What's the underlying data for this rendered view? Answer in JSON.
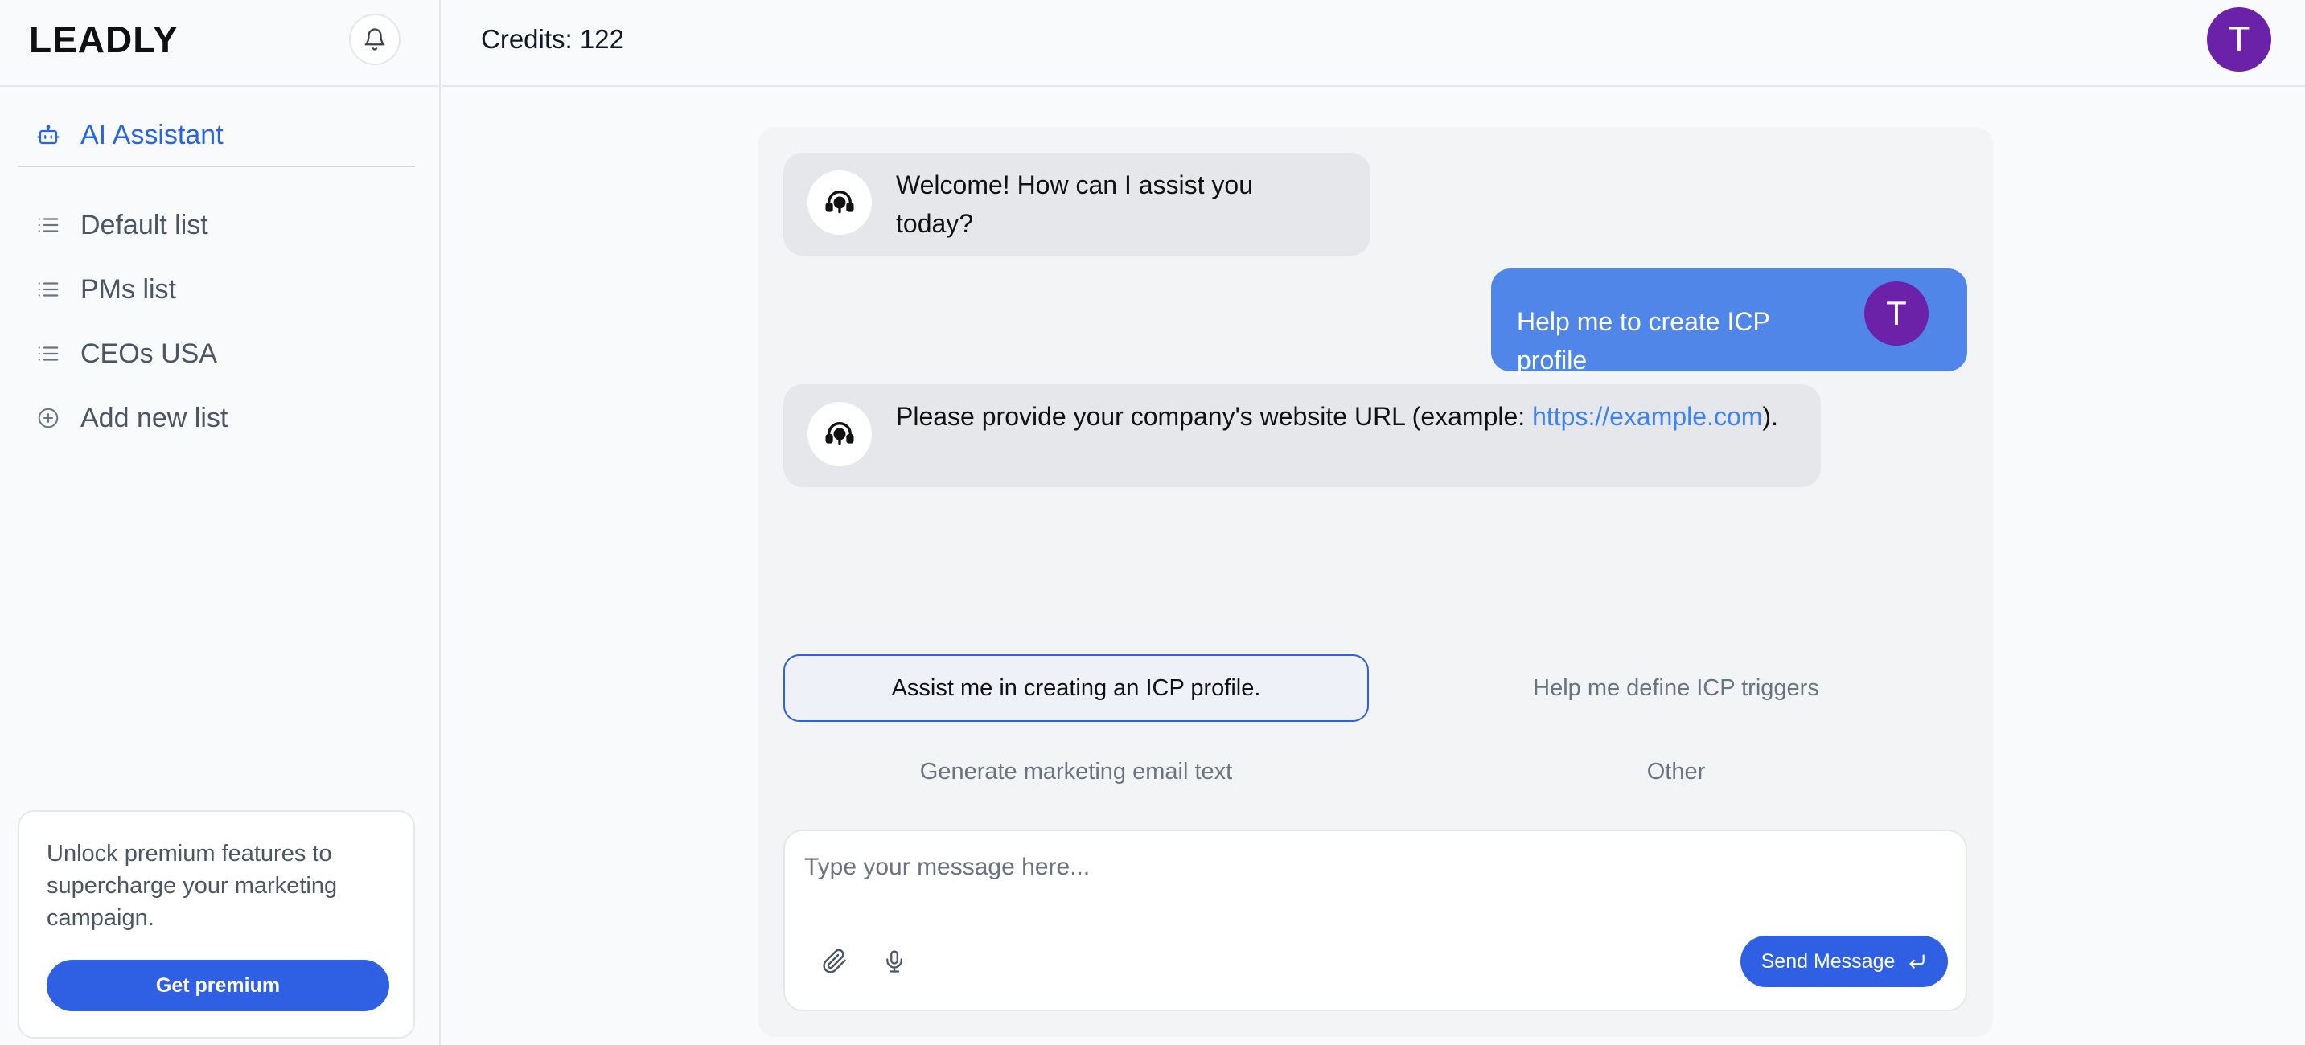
{
  "app": {
    "logo_text": "LEADLY"
  },
  "sidebar": {
    "assistant_label": "AI Assistant",
    "lists": [
      {
        "label": "Default list"
      },
      {
        "label": "PMs list"
      },
      {
        "label": "CEOs USA"
      }
    ],
    "add_list_label": "Add new list",
    "premium": {
      "text": "Unlock premium features to supercharge your marketing campaign.",
      "button_label": "Get premium"
    }
  },
  "header": {
    "credits_label": "Credits: 122",
    "avatar_initial": "T"
  },
  "chat": {
    "messages": [
      {
        "role": "bot",
        "text": "Welcome! How can I assist you today?"
      },
      {
        "role": "user",
        "text": "Help me to create ICP profile",
        "avatar_initial": "T"
      },
      {
        "role": "bot",
        "text_before": "Please provide your company's website URL (example: ",
        "link": "https://example.com",
        "text_after": ")."
      }
    ],
    "suggestions": [
      {
        "label": "Assist me in creating an ICP profile.",
        "selected": true
      },
      {
        "label": "Help me define ICP triggers",
        "selected": false
      },
      {
        "label": "Generate marketing email text",
        "selected": false
      },
      {
        "label": "Other",
        "selected": false
      }
    ],
    "input": {
      "placeholder": "Type your message here...",
      "value": ""
    },
    "send_label": "Send Message"
  },
  "colors": {
    "accent": "#2f5fe3",
    "user_bubble": "#4f86e8",
    "avatar": "#6b21a8",
    "link": "#3b82f6"
  }
}
